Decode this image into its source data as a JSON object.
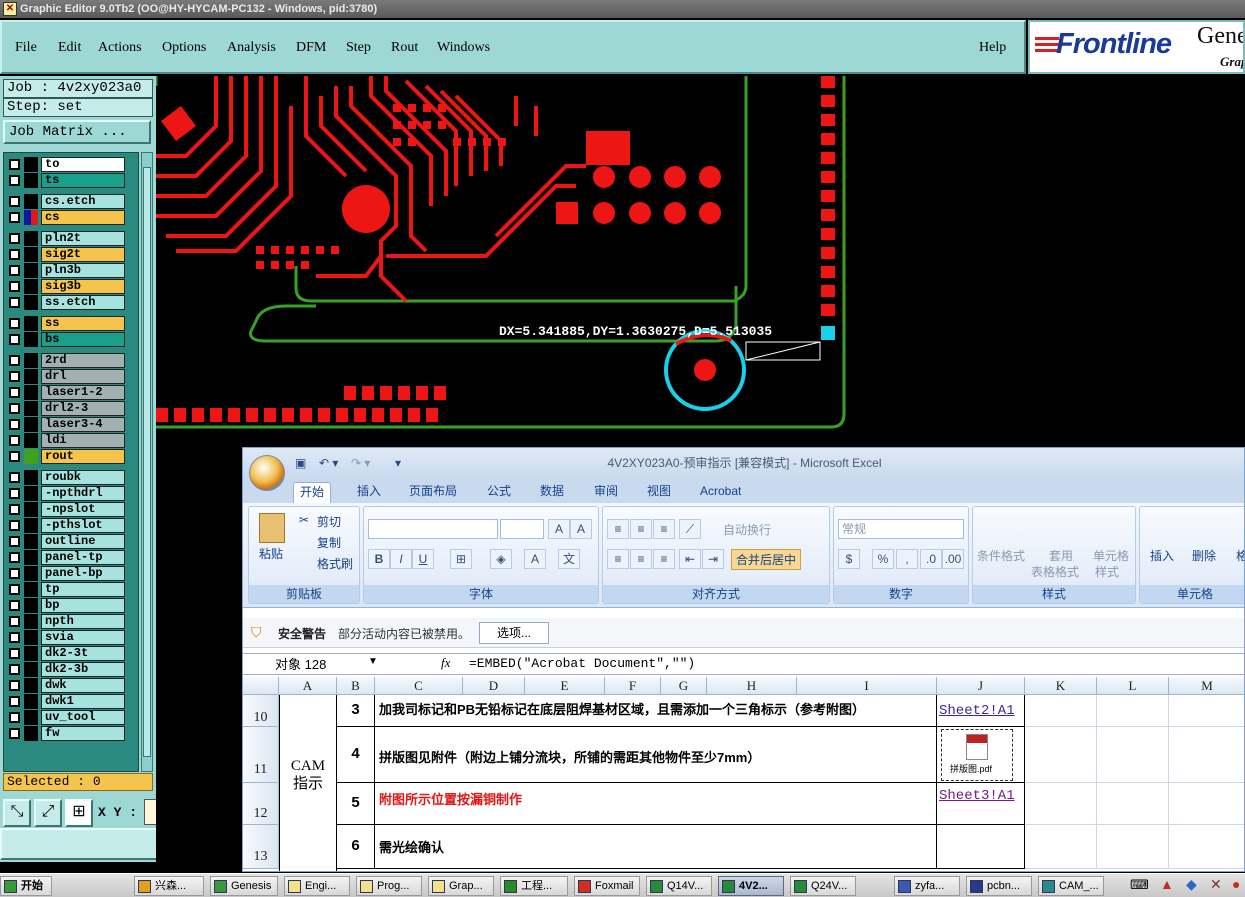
{
  "window": {
    "title": "Graphic Editor 9.0Tb2 (OO@HY-HYCAM-PC132 - Windows, pid:3780)"
  },
  "menu": {
    "items": [
      "File",
      "Edit",
      "Actions",
      "Options",
      "Analysis",
      "DFM",
      "Step",
      "Rout",
      "Windows"
    ],
    "help": "Help"
  },
  "logo": {
    "brand": "Frontline",
    "product": "Gene",
    "sub": "Grap"
  },
  "job": {
    "job_label": "Job : 4v2xy023a0",
    "step_label": "Step: set",
    "matrix_button": "Job Matrix ..."
  },
  "layers": [
    {
      "name": "to",
      "color": "#ffffff",
      "swatch": "#000000"
    },
    {
      "name": "ts",
      "color": "#1aa08a",
      "swatch": "#000000"
    },
    {
      "name": "cs.etch",
      "color": "#a6e3de",
      "swatch": "#000000"
    },
    {
      "name": "cs",
      "color": "#f5c44c",
      "swatch": "#e01818",
      "marker": "⊞"
    },
    {
      "name": "pln2t",
      "color": "#a6e3de",
      "swatch": "#000000"
    },
    {
      "name": "sig2t",
      "color": "#f5c44c",
      "swatch": "#000000"
    },
    {
      "name": "pln3b",
      "color": "#a6e3de",
      "swatch": "#000000"
    },
    {
      "name": "sig3b",
      "color": "#f5c44c",
      "swatch": "#000000"
    },
    {
      "name": "ss.etch",
      "color": "#a6e3de",
      "swatch": "#000000"
    },
    {
      "name": "ss",
      "color": "#f5c44c",
      "swatch": "#000000"
    },
    {
      "name": "bs",
      "color": "#1aa08a",
      "swatch": "#000000"
    },
    {
      "name": "2rd",
      "color": "#a3b0b3",
      "swatch": "#000000"
    },
    {
      "name": "drl",
      "color": "#a3b0b3",
      "swatch": "#000000"
    },
    {
      "name": "laser1-2",
      "color": "#a3b0b3",
      "swatch": "#000000"
    },
    {
      "name": "drl2-3",
      "color": "#a3b0b3",
      "swatch": "#000000"
    },
    {
      "name": "laser3-4",
      "color": "#a3b0b3",
      "swatch": "#000000"
    },
    {
      "name": "ldi",
      "color": "#a3b0b3",
      "swatch": "#000000"
    },
    {
      "name": "rout",
      "color": "#f5c44c",
      "swatch": "#40a020"
    },
    {
      "name": "roubk",
      "color": "#a6e3de",
      "swatch": "#000000"
    },
    {
      "name": "-npthdrl",
      "color": "#a6e3de",
      "swatch": "#000000"
    },
    {
      "name": "-npslot",
      "color": "#a6e3de",
      "swatch": "#000000"
    },
    {
      "name": "-pthslot",
      "color": "#a6e3de",
      "swatch": "#000000"
    },
    {
      "name": "outline",
      "color": "#a6e3de",
      "swatch": "#000000"
    },
    {
      "name": "panel-tp",
      "color": "#a6e3de",
      "swatch": "#000000"
    },
    {
      "name": "panel-bp",
      "color": "#a6e3de",
      "swatch": "#000000"
    },
    {
      "name": "tp",
      "color": "#a6e3de",
      "swatch": "#000000"
    },
    {
      "name": "bp",
      "color": "#a6e3de",
      "swatch": "#000000"
    },
    {
      "name": "npth",
      "color": "#a6e3de",
      "swatch": "#000000"
    },
    {
      "name": "svia",
      "color": "#a6e3de",
      "swatch": "#000000"
    },
    {
      "name": "dk2-3t",
      "color": "#a6e3de",
      "swatch": "#000000"
    },
    {
      "name": "dk2-3b",
      "color": "#a6e3de",
      "swatch": "#000000"
    },
    {
      "name": "dwk",
      "color": "#a6e3de",
      "swatch": "#000000"
    },
    {
      "name": "dwk1",
      "color": "#a6e3de",
      "swatch": "#000000"
    },
    {
      "name": "uv_tool",
      "color": "#a6e3de",
      "swatch": "#000000"
    },
    {
      "name": "fw",
      "color": "#a6e3de",
      "swatch": "#000000"
    }
  ],
  "selected": "Selected : 0",
  "xy_label": "X Y :",
  "measure": "DX=5.341885,DY=1.3630275,D=5.513035",
  "excel": {
    "title": "4V2XY023A0-预审指示  [兼容模式] - Microsoft Excel",
    "tabs": [
      "开始",
      "插入",
      "页面布局",
      "公式",
      "数据",
      "审阅",
      "视图",
      "Acrobat"
    ],
    "clipboard": {
      "cut": "剪切",
      "copy": "复制",
      "painter": "格式刷",
      "paste": "粘贴",
      "label": "剪贴板"
    },
    "font_group": "字体",
    "align": {
      "wrap": "自动换行",
      "merge": "合并后居中",
      "label": "对齐方式"
    },
    "number": {
      "format": "常规",
      "label": "数字"
    },
    "styles": {
      "cond": "条件格式",
      "table_a": "套用",
      "table_b": "表格格式",
      "cell_a": "单元格",
      "cell_b": "样式",
      "label": "样式"
    },
    "cells": {
      "insert": "插入",
      "delete": "删除",
      "format": "格",
      "label": "单元格"
    },
    "security": {
      "title": "安全警告",
      "msg": "部分活动内容已被禁用。",
      "button": "选项..."
    },
    "namebox": "对象 128",
    "formula": "=EMBED(\"Acrobat Document\",\"\")",
    "columns": [
      "A",
      "B",
      "C",
      "D",
      "E",
      "F",
      "G",
      "H",
      "I",
      "J",
      "K",
      "L",
      "M"
    ],
    "merged_label": "CAM\n指示",
    "rows": [
      {
        "rownum": "10",
        "num": "3",
        "text": "加我司标记和PB无铅标记在底层阻焊基材区域，且需添加一个三角标示（参考附图）",
        "link": "Sheet2!A1",
        "red": false
      },
      {
        "rownum": "11",
        "num": "4",
        "text": "拼版图见附件（附边上铺分流块，所铺的需距其他物件至少7mm）",
        "link": "",
        "red": false
      },
      {
        "rownum": "12",
        "num": "5",
        "text": "附图所示位置按漏铜制作",
        "link": "Sheet3!A1",
        "red": true
      },
      {
        "rownum": "13",
        "num": "6",
        "text": "需光绘确认",
        "link": "",
        "red": false
      }
    ],
    "pdf_label": "拼版图.pdf"
  },
  "taskbar": {
    "start": "开始",
    "tasks": [
      "兴森...",
      "Genesis",
      "Engi...",
      "Prog...",
      "Grap...",
      "工程...",
      "Foxmail",
      "Q14V...",
      "4V2...",
      "Q24V...",
      "zyfa...",
      "pcbn...",
      "CAM_..."
    ]
  }
}
